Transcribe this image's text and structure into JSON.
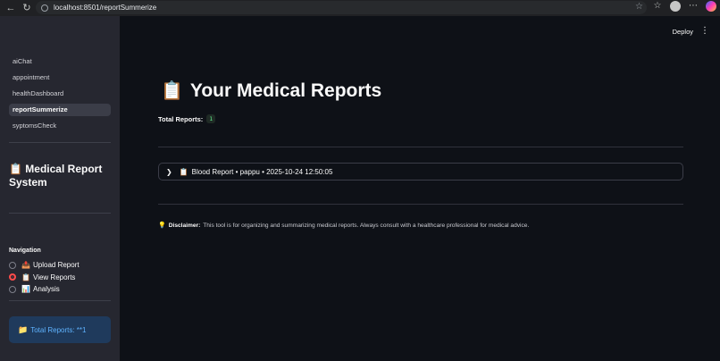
{
  "browser": {
    "url": "localhost:8501/reportSummerize"
  },
  "sidebar": {
    "pages": [
      {
        "label": "aiChat"
      },
      {
        "label": "appointment"
      },
      {
        "label": "healthDashboard"
      },
      {
        "label": "reportSummerize",
        "active": true
      },
      {
        "label": "syptomsCheck"
      }
    ],
    "system_title": "Medical Report System",
    "system_title_icon": "📋",
    "navigation_label": "Navigation",
    "radio_options": [
      {
        "label": "Upload Report",
        "icon": "📤",
        "checked": false
      },
      {
        "label": "View Reports",
        "icon": "📋",
        "checked": true
      },
      {
        "label": "Analysis",
        "icon": "📊",
        "checked": false
      }
    ],
    "info_box": {
      "icon": "📁",
      "text": "Total Reports: **1"
    }
  },
  "header": {
    "deploy_label": "Deploy",
    "menu_icon": "⋮"
  },
  "main": {
    "title": "Your Medical Reports",
    "title_icon": "📋",
    "total_label": "Total Reports:",
    "total_value": "1",
    "report": {
      "icon": "📋",
      "text": "Blood Report • pappu • 2025-10-24 12:50:05"
    },
    "disclaimer": {
      "icon": "💡",
      "label": "Disclaimer:",
      "text": "This tool is for organizing and summarizing medical reports. Always consult with a healthcare professional for medical advice."
    }
  },
  "colors": {
    "background": "#0e1117",
    "sidebar": "#262730",
    "accent": "#ff4b4b",
    "info_text": "#5fb3ff"
  }
}
